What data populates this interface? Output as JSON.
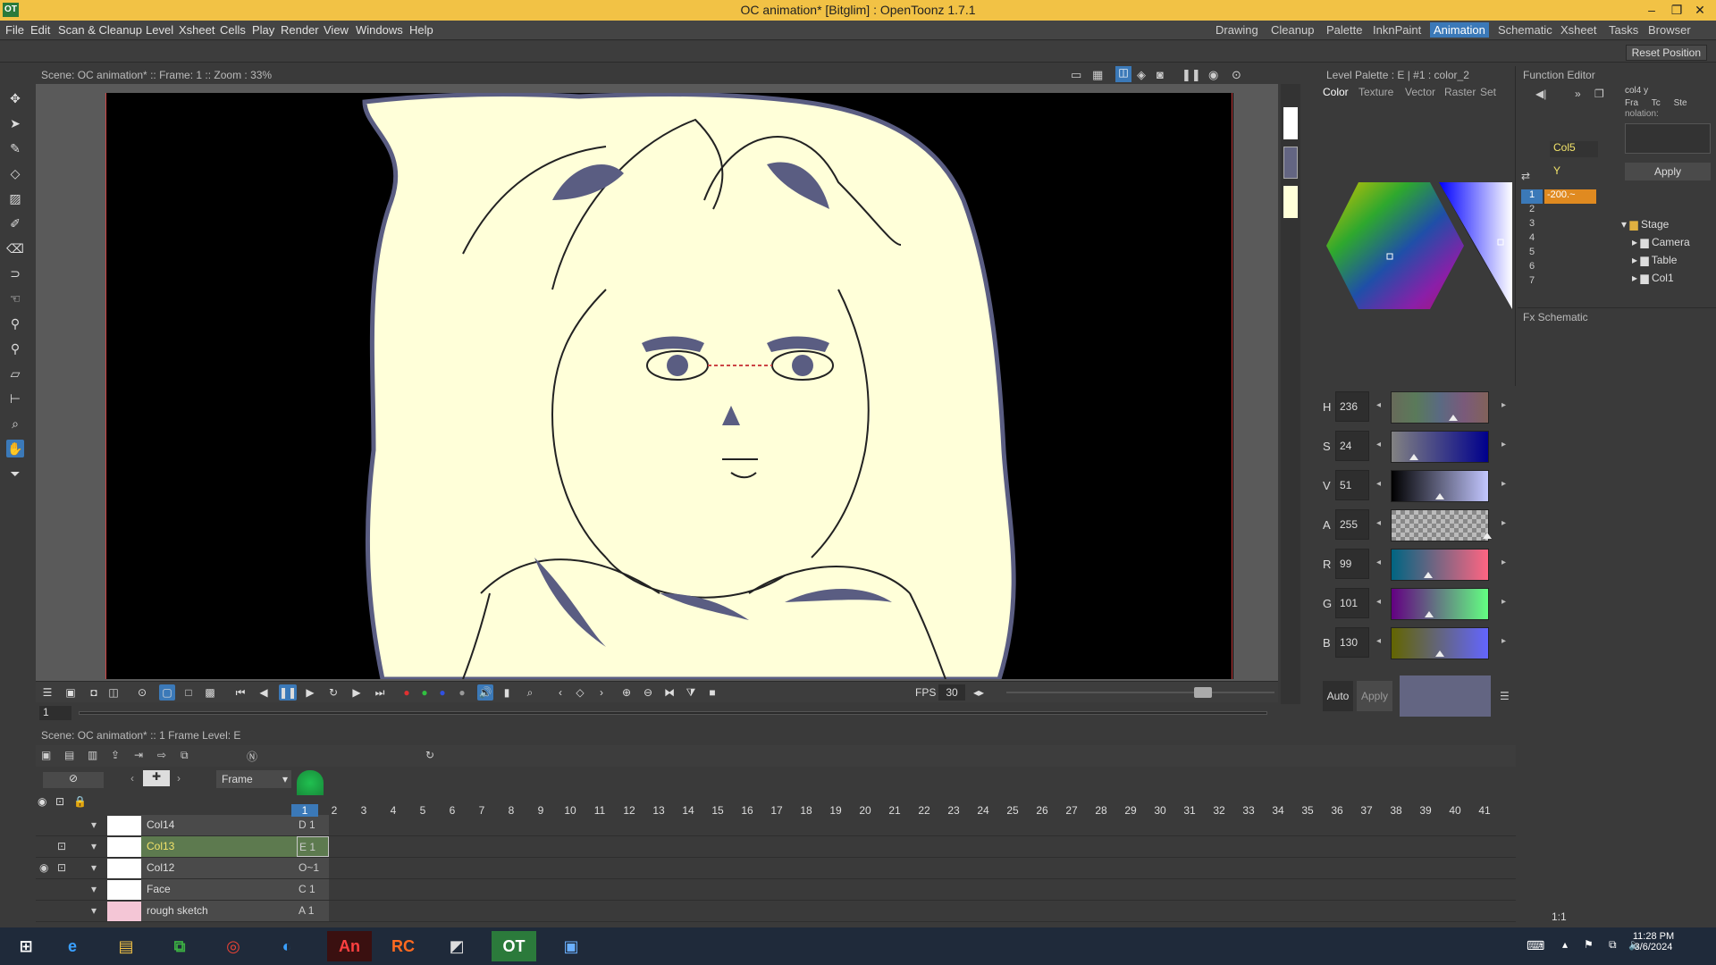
{
  "window": {
    "title": "OC animation* [Bitglim] : OpenToonz 1.7.1",
    "logo": "OT"
  },
  "menu": [
    "File",
    "Edit",
    "Scan & Cleanup",
    "Level",
    "Xsheet",
    "Cells",
    "Play",
    "Render",
    "View",
    "Windows",
    "Help"
  ],
  "rooms": [
    "Drawing",
    "Cleanup",
    "Palette",
    "InknPaint",
    "Animation",
    "Schematic",
    "Xsheet",
    "Tasks",
    "Browser"
  ],
  "active_room": "Animation",
  "reset_position": "Reset Position",
  "viewer": {
    "header": "Scene: OC animation*  ::  Frame: 1  ::  Zoom : 33%",
    "fps_label": "FPS",
    "fps_value": "30",
    "frame_field": "1"
  },
  "level_palette": {
    "header": "Level Palette : E | #1 : color_2",
    "tabs": [
      "Color",
      "Texture",
      "Vector",
      "Raster",
      "Set"
    ],
    "sliders": [
      {
        "label": "H",
        "value": "236",
        "pos": 0.65
      },
      {
        "label": "S",
        "value": "24",
        "pos": 0.24
      },
      {
        "label": "V",
        "value": "51",
        "pos": 0.51
      },
      {
        "label": "A",
        "value": "255",
        "pos": 1.0
      },
      {
        "label": "R",
        "value": "99",
        "pos": 0.39
      },
      {
        "label": "G",
        "value": "101",
        "pos": 0.4
      },
      {
        "label": "B",
        "value": "130",
        "pos": 0.51
      }
    ],
    "auto_label": "Auto",
    "apply_label": "Apply",
    "current_color": "#636582"
  },
  "function_editor": {
    "title": "Function Editor",
    "col_labels": [
      "Fra",
      "Tc",
      "Ste"
    ],
    "top_truncated": "col4 y",
    "interpolation_truncated": "nolation:",
    "curve_label": "Col5",
    "channel_label": "Y",
    "value_row1": "-200.~",
    "rows": [
      "1",
      "2",
      "3",
      "4",
      "5",
      "6",
      "7"
    ],
    "apply_label": "Apply",
    "tree": [
      "Stage",
      "Camera",
      "Table",
      "Col1"
    ]
  },
  "fx_schematic": {
    "title": "Fx Schematic"
  },
  "xsheet": {
    "header": "Scene: OC animation*  ::  1 Frame  Level: E",
    "frame_dropdown": "Frame",
    "frames": [
      "1",
      "2",
      "3",
      "4",
      "5",
      "6",
      "7",
      "8",
      "9",
      "10",
      "11",
      "12",
      "13",
      "14",
      "15",
      "16",
      "17",
      "18",
      "19",
      "20",
      "21",
      "22",
      "23",
      "24",
      "25",
      "26",
      "27",
      "28",
      "29",
      "30",
      "31",
      "32",
      "33",
      "34",
      "35",
      "36",
      "37",
      "38",
      "39",
      "40",
      "41"
    ],
    "columns": [
      {
        "name": "Col14",
        "cell": "D",
        "num": "1"
      },
      {
        "name": "Col13",
        "cell": "E",
        "num": "1"
      },
      {
        "name": "Col12",
        "cell": "O~",
        "num": "1"
      },
      {
        "name": "Face",
        "cell": "C",
        "num": "1"
      },
      {
        "name": "rough sketch",
        "cell": "A",
        "num": "1"
      }
    ],
    "zoom_label": "1:1"
  },
  "taskbar": {
    "time": "11:28 PM",
    "date": "3/6/2024"
  }
}
